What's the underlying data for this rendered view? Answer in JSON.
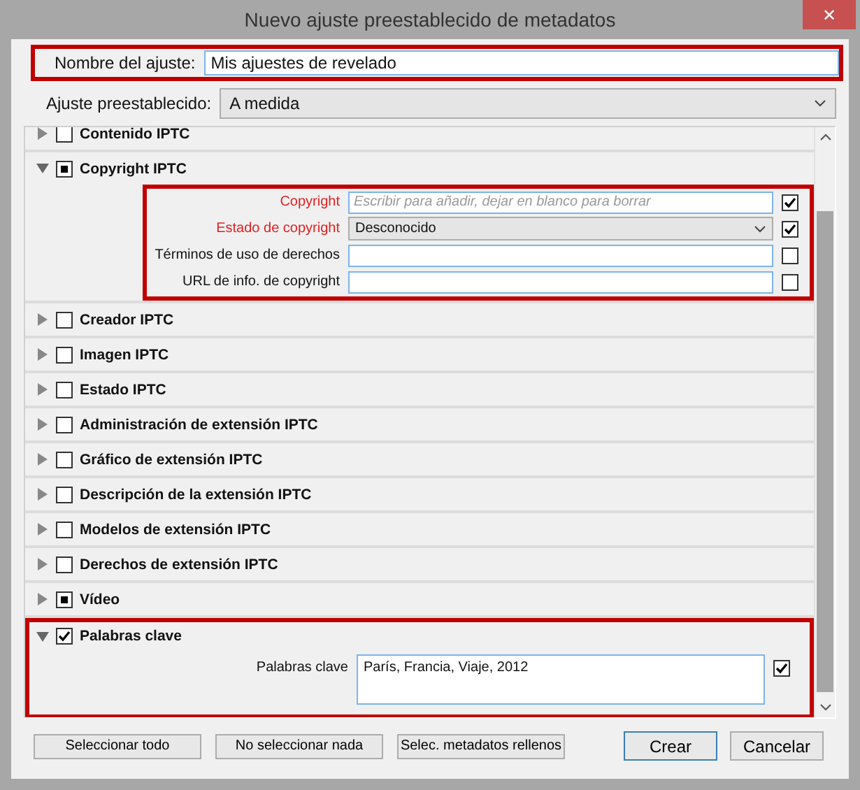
{
  "window": {
    "title": "Nuevo ajuste preestablecido de metadatos",
    "close": "✕"
  },
  "name_field": {
    "label": "Nombre del ajuste:",
    "value": "Mis ajuestes de revelado",
    "highlighted": true
  },
  "preset_select": {
    "label": "Ajuste preestablecido:",
    "value": "A medida"
  },
  "sections": [
    {
      "title": "Contenido IPTC",
      "expanded": false,
      "checked": false,
      "partial": false
    },
    {
      "title": "Copyright IPTC",
      "expanded": true,
      "checked": false,
      "partial": true,
      "fields_highlighted": true,
      "fields": [
        {
          "label": "Copyright",
          "kind": "input",
          "placeholder": "Escribir para añadir, dejar en blanco para borrar",
          "required": true,
          "checked": true
        },
        {
          "label": "Estado de copyright",
          "kind": "select",
          "value": "Desconocido",
          "required": true,
          "checked": true
        },
        {
          "label": "Términos de uso de derechos",
          "kind": "input",
          "required": false,
          "checked": false
        },
        {
          "label": "URL de info. de copyright",
          "kind": "input",
          "required": false,
          "checked": false
        }
      ]
    },
    {
      "title": "Creador IPTC",
      "expanded": false,
      "checked": false,
      "partial": false
    },
    {
      "title": "Imagen IPTC",
      "expanded": false,
      "checked": false,
      "partial": false
    },
    {
      "title": "Estado IPTC",
      "expanded": false,
      "checked": false,
      "partial": false
    },
    {
      "title": "Administración de extensión IPTC",
      "expanded": false,
      "checked": false,
      "partial": false
    },
    {
      "title": "Gráfico de extensión IPTC",
      "expanded": false,
      "checked": false,
      "partial": false
    },
    {
      "title": "Descripción de la extensión IPTC",
      "expanded": false,
      "checked": false,
      "partial": false
    },
    {
      "title": "Modelos de extensión IPTC",
      "expanded": false,
      "checked": false,
      "partial": false
    },
    {
      "title": "Derechos de extensión IPTC",
      "expanded": false,
      "checked": false,
      "partial": false
    },
    {
      "title": "Vídeo",
      "expanded": false,
      "checked": false,
      "partial": true
    },
    {
      "title": "Palabras clave",
      "expanded": true,
      "checked": true,
      "partial": false,
      "highlighted": true,
      "fields": [
        {
          "label": "Palabras clave",
          "kind": "textarea",
          "value": "París, Francia, Viaje, 2012",
          "required": false,
          "checked": true
        }
      ]
    }
  ],
  "left_buttons": [
    {
      "label": "Seleccionar todo",
      "default": false
    },
    {
      "label": "No seleccionar nada",
      "default": false
    },
    {
      "label": "Selec. metadatos rellenos",
      "default": false
    }
  ],
  "right_buttons": [
    {
      "label": "Crear",
      "default": true
    },
    {
      "label": "Cancelar",
      "default": false
    }
  ]
}
